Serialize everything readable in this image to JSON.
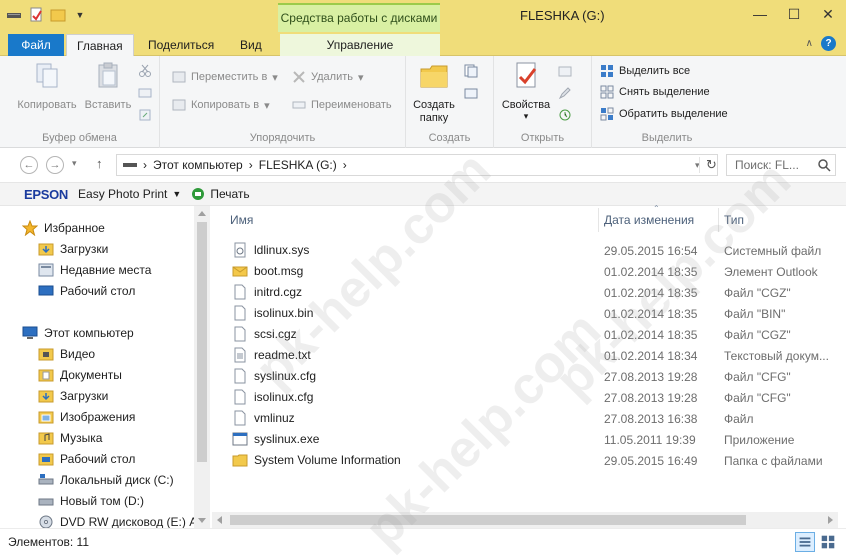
{
  "window": {
    "title": "FLESHKA (G:)",
    "tools_context": "Средства работы с дисками"
  },
  "tabs": {
    "file": "Файл",
    "home": "Главная",
    "share": "Поделиться",
    "view": "Вид",
    "manage": "Управление"
  },
  "ribbon": {
    "clipboard": {
      "label": "Буфер обмена",
      "copy": "Копировать",
      "paste": "Вставить"
    },
    "organize": {
      "label": "Упорядочить",
      "move_to": "Переместить в",
      "copy_to": "Копировать в",
      "delete": "Удалить",
      "rename": "Переименовать"
    },
    "new": {
      "label": "Создать",
      "new_folder": "Создать папку"
    },
    "open": {
      "label": "Открыть",
      "properties": "Свойства"
    },
    "select": {
      "label": "Выделить",
      "select_all": "Выделить все",
      "select_none": "Снять выделение",
      "invert": "Обратить выделение"
    }
  },
  "address": {
    "crumbs": [
      "Этот компьютер",
      "FLESHKA (G:)"
    ],
    "search_placeholder": "Поиск: FL..."
  },
  "epson": {
    "logo": "EPSON",
    "app": "Easy Photo Print",
    "print": "Печать"
  },
  "nav": {
    "favorites": "Избранное",
    "fav_items": [
      "Загрузки",
      "Недавние места",
      "Рабочий стол"
    ],
    "computer": "Этот компьютер",
    "pc_items": [
      "Видео",
      "Документы",
      "Загрузки",
      "Изображения",
      "Музыка",
      "Рабочий стол",
      "Локальный диск (C:)",
      "Новый том (D:)",
      "DVD RW дисковод (E:) Au"
    ]
  },
  "columns": {
    "name": "Имя",
    "date": "Дата изменения",
    "type": "Тип"
  },
  "files": [
    {
      "name": "ldlinux.sys",
      "date": "29.05.2015 16:54",
      "type": "Системный файл",
      "icon": "system-file-icon"
    },
    {
      "name": "boot.msg",
      "date": "01.02.2014 18:35",
      "type": "Элемент Outlook",
      "icon": "mail-icon"
    },
    {
      "name": "initrd.cgz",
      "date": "01.02.2014 18:35",
      "type": "Файл \"CGZ\"",
      "icon": "file-icon"
    },
    {
      "name": "isolinux.bin",
      "date": "01.02.2014 18:35",
      "type": "Файл \"BIN\"",
      "icon": "file-icon"
    },
    {
      "name": "scsi.cgz",
      "date": "01.02.2014 18:35",
      "type": "Файл \"CGZ\"",
      "icon": "file-icon"
    },
    {
      "name": "readme.txt",
      "date": "01.02.2014 18:34",
      "type": "Текстовый докум...",
      "icon": "text-file-icon"
    },
    {
      "name": "syslinux.cfg",
      "date": "27.08.2013 19:28",
      "type": "Файл \"CFG\"",
      "icon": "file-icon"
    },
    {
      "name": "isolinux.cfg",
      "date": "27.08.2013 19:28",
      "type": "Файл \"CFG\"",
      "icon": "file-icon"
    },
    {
      "name": "vmlinuz",
      "date": "27.08.2013 16:38",
      "type": "Файл",
      "icon": "file-icon"
    },
    {
      "name": "syslinux.exe",
      "date": "11.05.2011 19:39",
      "type": "Приложение",
      "icon": "exe-icon"
    },
    {
      "name": "System Volume Information",
      "date": "29.05.2015 16:49",
      "type": "Папка с файлами",
      "icon": "folder-icon"
    }
  ],
  "status": {
    "items": "Элементов: 11"
  },
  "watermark": "pk-help.com"
}
